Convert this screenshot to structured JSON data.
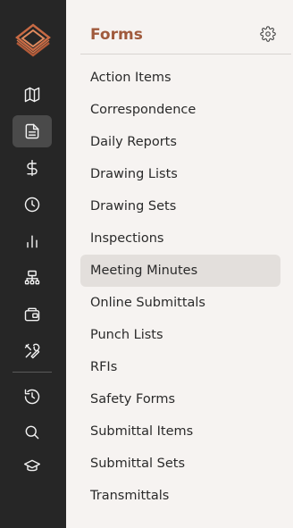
{
  "rail": {
    "items": [
      {
        "icon": "map-icon",
        "active": false
      },
      {
        "icon": "document-icon",
        "active": true
      },
      {
        "icon": "dollar-icon",
        "active": false
      },
      {
        "icon": "clock-icon",
        "active": false
      },
      {
        "icon": "bar-chart-icon",
        "active": false
      },
      {
        "icon": "hierarchy-icon",
        "active": false
      },
      {
        "icon": "wallet-icon",
        "active": false
      },
      {
        "icon": "tools-icon",
        "active": false
      },
      {
        "icon": "history-icon",
        "active": false
      },
      {
        "icon": "search-icon",
        "active": false
      },
      {
        "icon": "graduation-cap-icon",
        "active": false
      }
    ]
  },
  "panel": {
    "title": "Forms",
    "items": [
      "Action Items",
      "Correspondence",
      "Daily Reports",
      "Drawing Lists",
      "Drawing Sets",
      "Inspections",
      "Meeting Minutes",
      "Online Submittals",
      "Punch Lists",
      "RFIs",
      "Safety Forms",
      "Submittal Items",
      "Submittal Sets",
      "Transmittals"
    ],
    "selected_index": 6
  },
  "colors": {
    "rail_bg": "#262626",
    "accent": "#a05a3c",
    "selected_bg": "#e3dfdc"
  }
}
